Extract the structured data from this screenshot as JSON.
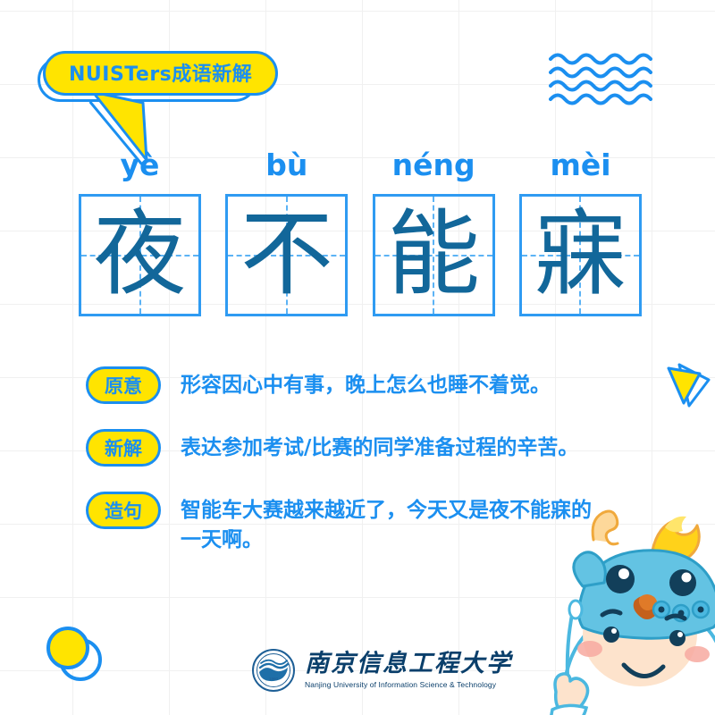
{
  "theme": {
    "blue": "#1b8ff0",
    "yellow": "#ffe400",
    "ink": "#12679a",
    "grid": "#f0f0f0",
    "background": "#ffffff",
    "logo_navy": "#0a3f6b"
  },
  "header": {
    "bubble_title": "NUISTers成语新解"
  },
  "idiom": {
    "cells": [
      {
        "pinyin": "yè",
        "char": "夜"
      },
      {
        "pinyin": "bù",
        "char": "不"
      },
      {
        "pinyin": "néng",
        "char": "能"
      },
      {
        "pinyin": "mèi",
        "char": "寐"
      }
    ]
  },
  "definitions": [
    {
      "label": "原意",
      "text": "形容因心中有事，晚上怎么也睡不着觉。"
    },
    {
      "label": "新解",
      "text": "表达参加考试/比赛的同学准备过程的辛苦。"
    },
    {
      "label": "造句",
      "text": "智能车大赛越来越近了，今天又是夜不能寐的一天啊。"
    }
  ],
  "decorations": {
    "waves_icon": "wavy-lines-icon",
    "triangle_icon": "triangle-decoration-icon",
    "circle_icon": "circle-decoration-icon",
    "mascot_icon": "dragon-hood-child-mascot"
  },
  "footer": {
    "logo_seal_icon": "university-seal-icon",
    "university_cn": "南京信息工程大学",
    "university_en": "Nanjing University of Information Science & Technology"
  }
}
